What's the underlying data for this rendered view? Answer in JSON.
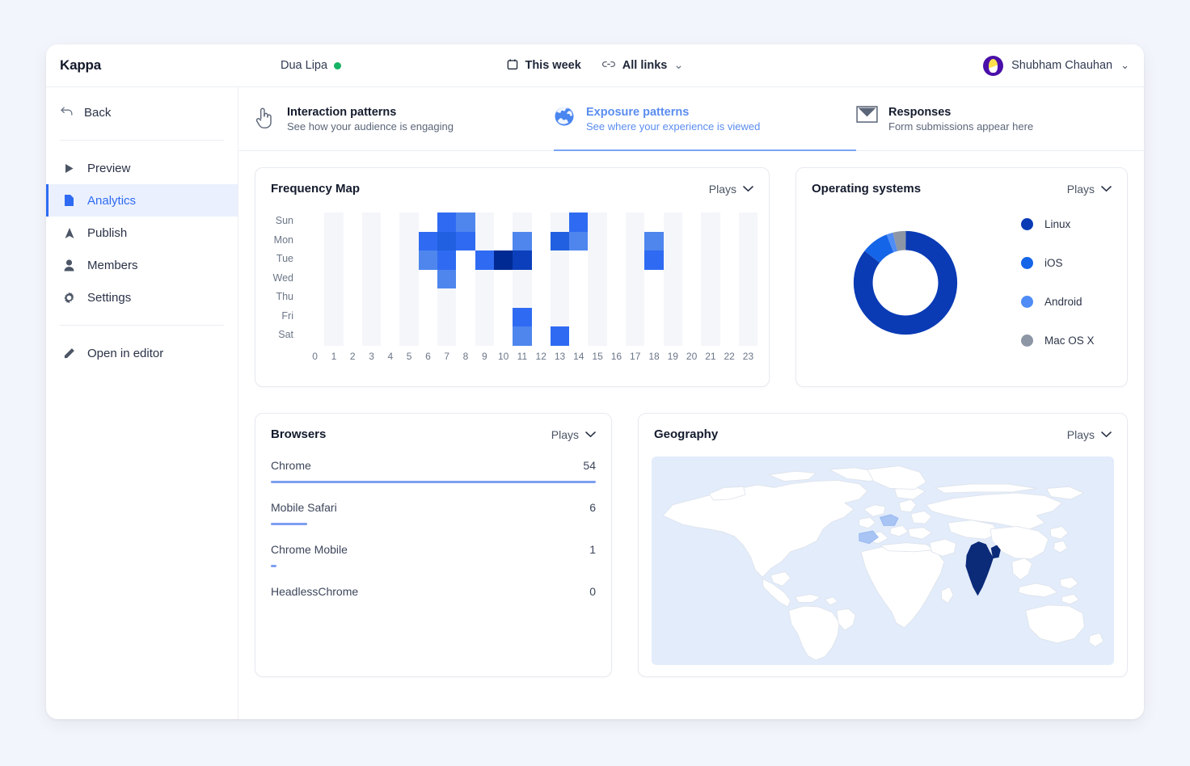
{
  "topbar": {
    "brand": "Kappa",
    "project_name": "Dua Lipa",
    "status_dot": "online-dot",
    "date_range": "This week",
    "links_filter": "All links",
    "links_chevron": "⌄",
    "user_name": "Shubham Chauhan",
    "user_chevron": "⌄",
    "calendar_icon": "calendar-icon",
    "link_icon": "link-icon"
  },
  "sidebar": {
    "back_label": "Back",
    "back_icon": "back-arrow-icon",
    "items": [
      {
        "label": "Preview",
        "icon": "play-icon",
        "active": false
      },
      {
        "label": "Analytics",
        "icon": "document-icon",
        "active": true
      },
      {
        "label": "Publish",
        "icon": "upload-icon",
        "active": false
      },
      {
        "label": "Members",
        "icon": "person-icon",
        "active": false
      },
      {
        "label": "Settings",
        "icon": "gear-icon",
        "active": false
      }
    ],
    "footer_item": {
      "label": "Open in editor",
      "icon": "pencil-icon"
    }
  },
  "tabs": [
    {
      "title": "Interaction patterns",
      "subtitle": "See how your audience is engaging",
      "icon": "hand-pointer-icon",
      "active": false
    },
    {
      "title": "Exposure patterns",
      "subtitle": "See where your experience is viewed",
      "icon": "globe-icon",
      "active": true
    },
    {
      "title": "Responses",
      "subtitle": "Form submissions appear here",
      "icon": "envelope-icon",
      "active": false
    }
  ],
  "panels": {
    "frequency": {
      "title": "Frequency Map",
      "metric": "Plays",
      "chevron": "⌄"
    },
    "os": {
      "title": "Operating systems",
      "metric": "Plays",
      "chevron": "⌄"
    },
    "browsers": {
      "title": "Browsers",
      "metric": "Plays",
      "chevron": "⌄"
    },
    "geography": {
      "title": "Geography",
      "metric": "Plays",
      "chevron": "⌄"
    }
  },
  "colors": {
    "accent": "#2f6bf2",
    "scale_0": "#ffffff",
    "scale_1": "#7aa1f2",
    "scale_2": "#4e86ee",
    "scale_3": "#2f6bf2",
    "scale_4": "#2160e0",
    "scale_5": "#0c3fbb",
    "scale_6": "#002a93",
    "alt_column": "#f5f6fa",
    "linux": "#0a3bb5",
    "ios": "#1565e8",
    "android": "#4f8cf5",
    "macosx": "#8d96a5",
    "bar": "#7d9ff0",
    "map_bg": "#e2ecfb",
    "map_land": "#ffffff",
    "map_high": "#0b2a78",
    "map_mid": "#a8c4f4"
  },
  "chart_data": [
    {
      "type": "heatmap",
      "title": "Frequency Map",
      "metric": "Plays",
      "xlabel": "",
      "ylabel": "",
      "x": [
        "0",
        "1",
        "2",
        "3",
        "4",
        "5",
        "6",
        "7",
        "8",
        "9",
        "10",
        "11",
        "12",
        "13",
        "14",
        "15",
        "16",
        "17",
        "18",
        "19",
        "20",
        "21",
        "22",
        "23"
      ],
      "y": [
        "Sun",
        "Mon",
        "Tue",
        "Wed",
        "Thu",
        "Fri",
        "Sat"
      ],
      "values": [
        [
          0,
          0,
          0,
          0,
          0,
          0,
          0,
          3,
          2,
          0,
          0,
          0,
          0,
          0,
          3,
          0,
          0,
          0,
          0,
          0,
          0,
          0,
          0,
          0
        ],
        [
          0,
          0,
          0,
          0,
          0,
          0,
          3,
          4,
          3,
          0,
          0,
          2,
          0,
          4,
          2,
          0,
          0,
          0,
          2,
          0,
          0,
          0,
          0,
          0
        ],
        [
          0,
          0,
          0,
          0,
          0,
          0,
          2,
          3,
          0,
          3,
          6,
          5,
          0,
          0,
          0,
          0,
          0,
          0,
          3,
          0,
          0,
          0,
          0,
          0
        ],
        [
          0,
          0,
          0,
          0,
          0,
          0,
          0,
          2,
          0,
          0,
          0,
          0,
          0,
          0,
          0,
          0,
          0,
          0,
          0,
          0,
          0,
          0,
          0,
          0
        ],
        [
          0,
          0,
          0,
          0,
          0,
          0,
          0,
          0,
          0,
          0,
          0,
          0,
          0,
          0,
          0,
          0,
          0,
          0,
          0,
          0,
          0,
          0,
          0,
          0
        ],
        [
          0,
          0,
          0,
          0,
          0,
          0,
          0,
          0,
          0,
          0,
          0,
          3,
          0,
          0,
          0,
          0,
          0,
          0,
          0,
          0,
          0,
          0,
          0,
          0
        ],
        [
          0,
          0,
          0,
          0,
          0,
          0,
          0,
          0,
          0,
          0,
          0,
          2,
          0,
          3,
          0,
          0,
          0,
          0,
          0,
          0,
          0,
          0,
          0,
          0
        ]
      ],
      "scale_max": 6,
      "grid": false
    },
    {
      "type": "pie",
      "title": "Operating systems",
      "metric": "Plays",
      "labels": [
        "Linux",
        "iOS",
        "Android",
        "Mac OS X"
      ],
      "values": [
        85.5,
        8.5,
        2.0,
        4.0
      ],
      "colors": [
        "#0a3bb5",
        "#1565e8",
        "#4f8cf5",
        "#8d96a5"
      ],
      "legend": "right",
      "donut": true
    },
    {
      "type": "bar",
      "title": "Browsers",
      "metric": "Plays",
      "orientation": "horizontal",
      "categories": [
        "Chrome",
        "Mobile Safari",
        "Chrome Mobile",
        "HeadlessChrome"
      ],
      "values": [
        54,
        6,
        1,
        0
      ],
      "xlabel": "",
      "ylabel": "",
      "max": 54
    },
    {
      "type": "choropleth",
      "title": "Geography",
      "metric": "Plays",
      "regions": [
        {
          "name": "India",
          "level": "high"
        },
        {
          "name": "Germany",
          "level": "mid"
        },
        {
          "name": "Spain",
          "level": "mid"
        }
      ]
    }
  ]
}
